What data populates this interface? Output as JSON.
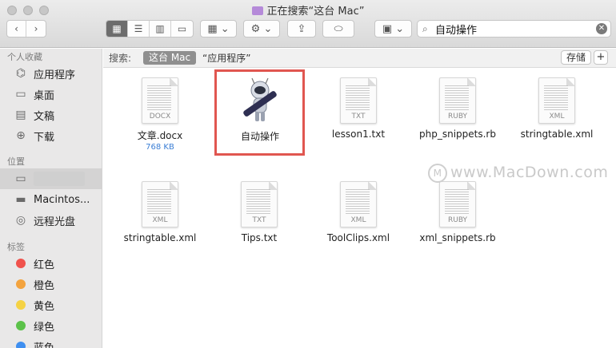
{
  "window": {
    "title": "正在搜索“这台 Mac”"
  },
  "toolbar": {
    "back_label": "‹",
    "forward_label": "›",
    "search_value": "自动操作"
  },
  "sidebar": {
    "favorites_header": "个人收藏",
    "favorites": [
      {
        "label": "应用程序",
        "icon": "applications-icon"
      },
      {
        "label": "桌面",
        "icon": "desktop-icon"
      },
      {
        "label": "文稿",
        "icon": "documents-icon"
      },
      {
        "label": "下载",
        "icon": "downloads-icon"
      }
    ],
    "locations_header": "位置",
    "locations": [
      {
        "label": "",
        "icon": "computer-icon"
      },
      {
        "label": "Macintos...",
        "icon": "disk-icon"
      },
      {
        "label": "远程光盘",
        "icon": "remote-disc-icon"
      }
    ],
    "tags_header": "标签",
    "tags": [
      {
        "label": "红色",
        "color": "#f0524c"
      },
      {
        "label": "橙色",
        "color": "#f3a33e"
      },
      {
        "label": "黄色",
        "color": "#f5d244"
      },
      {
        "label": "绿色",
        "color": "#5cc24a"
      },
      {
        "label": "蓝色",
        "color": "#3f8ff0"
      }
    ]
  },
  "scope": {
    "label": "搜索:",
    "active": "这台 Mac",
    "option": "“应用程序”",
    "save_label": "存储",
    "add_label": "+"
  },
  "files": [
    {
      "name": "文章.docx",
      "ext": "DOCX",
      "size": "768 KB"
    },
    {
      "name": "自动操作",
      "ext": "",
      "size": "",
      "selected": true
    },
    {
      "name": "lesson1.txt",
      "ext": "TXT"
    },
    {
      "name": "php_snippets.rb",
      "ext": "RUBY"
    },
    {
      "name": "stringtable.xml",
      "ext": "XML"
    },
    {
      "name": "stringtable.xml",
      "ext": "XML"
    },
    {
      "name": "Tips.txt",
      "ext": "TXT"
    },
    {
      "name": "ToolClips.xml",
      "ext": "XML"
    },
    {
      "name": "xml_snippets.rb",
      "ext": "RUBY"
    }
  ],
  "watermark": "www.MacDown.com"
}
